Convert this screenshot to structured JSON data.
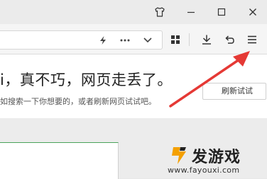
{
  "titlebar": {
    "icons": [
      "skin-icon",
      "minimize-icon",
      "maximize-icon",
      "close-icon"
    ]
  },
  "toolbar": {
    "address_icons": [
      "lightning-icon",
      "more-icon",
      "chevron-down-icon"
    ],
    "tool_icons": [
      "apps-grid-icon",
      "download-icon",
      "undo-icon",
      "menu-icon"
    ]
  },
  "error_page": {
    "headline": "i，真不巧，网页走丢了。",
    "subtext": "如搜索一下你想要的，或者刷新网页试试吧。",
    "refresh_button": "刷新试试"
  },
  "annotation": {
    "arrow_color": "#e53935"
  },
  "watermark": {
    "title": "发游戏",
    "url": "www.fayouxi.com",
    "brand_color": "#f4a000"
  }
}
